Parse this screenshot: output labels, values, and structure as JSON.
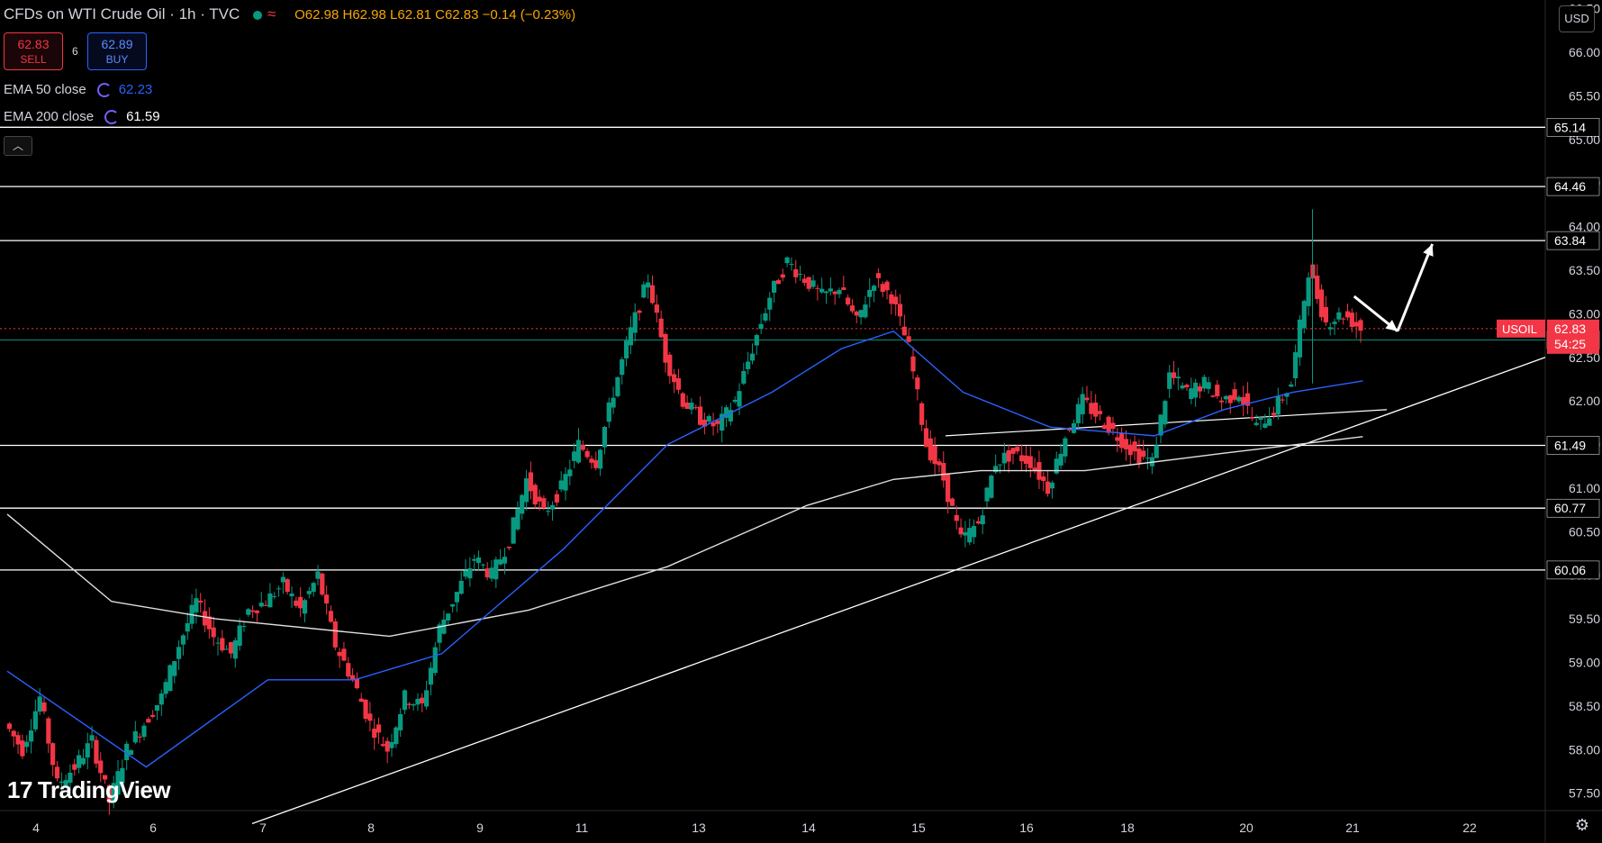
{
  "header": {
    "symbol_title": "CFDs on WTI Crude Oil · 1h · TVC",
    "open": "O62.98",
    "high": "H62.98",
    "low": "L62.81",
    "close": "C62.83",
    "change": "−0.14 (−0.23%)"
  },
  "trade": {
    "sell_price": "62.83",
    "sell_label": "SELL",
    "spread": "6",
    "buy_price": "62.89",
    "buy_label": "BUY"
  },
  "indicators": [
    {
      "label": "EMA 50 close",
      "value": "62.23",
      "color": "#2962ff"
    },
    {
      "label": "EMA 200 close",
      "value": "61.59",
      "color": "#ffffff"
    }
  ],
  "currency": "USD",
  "logo_text": "TradingView",
  "colors": {
    "up": "#089981",
    "down": "#f23645",
    "ema50": "#2962ff",
    "ema200": "#e0e0e0",
    "levels": "#ffffff",
    "background": "#000000"
  },
  "chart_data": {
    "type": "candlestick",
    "symbol": "USOIL",
    "interval": "1h",
    "y_ticks": [
      "57.50",
      "58.00",
      "58.50",
      "59.00",
      "59.50",
      "60.00",
      "60.50",
      "61.00",
      "61.50",
      "62.00",
      "62.50",
      "63.00",
      "63.50",
      "64.00",
      "64.50",
      "65.00",
      "65.50",
      "66.00",
      "66.50"
    ],
    "ylim": [
      57.3,
      66.6
    ],
    "x_ticks": [
      "4",
      "6",
      "7",
      "8",
      "9",
      "11",
      "13",
      "14",
      "15",
      "16",
      "18",
      "20",
      "21",
      "22"
    ],
    "horizontal_levels": [
      65.14,
      64.46,
      63.84,
      61.49,
      60.77,
      60.06
    ],
    "support_level": 62.7,
    "price_label": {
      "symbol": "USOIL",
      "price": "62.83",
      "countdown": "54:25"
    },
    "level_labels": [
      "65.14",
      "64.46",
      "63.84",
      "61.49",
      "60.77",
      "60.06",
      "62.70"
    ],
    "close_path": [
      [
        0,
        58.3
      ],
      [
        1,
        58.0
      ],
      [
        2,
        58.6
      ],
      [
        3,
        57.6
      ],
      [
        4,
        57.8
      ],
      [
        5,
        58.1
      ],
      [
        6,
        57.4
      ],
      [
        7,
        58.0
      ],
      [
        8,
        58.3
      ],
      [
        9,
        58.6
      ],
      [
        10,
        59.2
      ],
      [
        11,
        59.7
      ],
      [
        12,
        59.3
      ],
      [
        13,
        59.1
      ],
      [
        14,
        59.6
      ],
      [
        15,
        59.7
      ],
      [
        16,
        59.9
      ],
      [
        17,
        59.6
      ],
      [
        18,
        60.0
      ],
      [
        19,
        59.2
      ],
      [
        20,
        58.8
      ],
      [
        21,
        58.3
      ],
      [
        22,
        58.0
      ],
      [
        23,
        58.6
      ],
      [
        24,
        58.5
      ],
      [
        25,
        59.4
      ],
      [
        26,
        59.8
      ],
      [
        27,
        60.2
      ],
      [
        28,
        60.0
      ],
      [
        29,
        60.4
      ],
      [
        30,
        61.1
      ],
      [
        31,
        60.7
      ],
      [
        32,
        61.0
      ],
      [
        33,
        61.5
      ],
      [
        34,
        61.3
      ],
      [
        35,
        62.1
      ],
      [
        36,
        62.8
      ],
      [
        37,
        63.4
      ],
      [
        38,
        62.5
      ],
      [
        39,
        62.0
      ],
      [
        40,
        61.8
      ],
      [
        41,
        61.7
      ],
      [
        42,
        62.0
      ],
      [
        43,
        62.6
      ],
      [
        44,
        63.2
      ],
      [
        45,
        63.6
      ],
      [
        46,
        63.4
      ],
      [
        47,
        63.2
      ],
      [
        48,
        63.3
      ],
      [
        49,
        62.9
      ],
      [
        50,
        63.4
      ],
      [
        51,
        63.2
      ],
      [
        52,
        62.6
      ],
      [
        53,
        61.5
      ],
      [
        54,
        61.1
      ],
      [
        55,
        60.4
      ],
      [
        56,
        60.6
      ],
      [
        57,
        61.3
      ],
      [
        58,
        61.4
      ],
      [
        59,
        61.3
      ],
      [
        60,
        61.0
      ],
      [
        61,
        61.6
      ],
      [
        62,
        62.0
      ],
      [
        63,
        61.8
      ],
      [
        64,
        61.6
      ],
      [
        65,
        61.4
      ],
      [
        66,
        61.3
      ],
      [
        67,
        62.3
      ],
      [
        68,
        62.1
      ],
      [
        69,
        62.2
      ],
      [
        70,
        62.0
      ],
      [
        71,
        62.1
      ],
      [
        72,
        61.7
      ],
      [
        73,
        61.9
      ],
      [
        74,
        62.2
      ],
      [
        75,
        63.5
      ],
      [
        76,
        62.9
      ],
      [
        77,
        63.0
      ],
      [
        78,
        62.83
      ]
    ],
    "ema50_path": [
      [
        0,
        58.9
      ],
      [
        8,
        57.8
      ],
      [
        15,
        58.8
      ],
      [
        20,
        58.8
      ],
      [
        25,
        59.1
      ],
      [
        32,
        60.3
      ],
      [
        38,
        61.5
      ],
      [
        44,
        62.1
      ],
      [
        48,
        62.6
      ],
      [
        51,
        62.8
      ],
      [
        55,
        62.1
      ],
      [
        60,
        61.7
      ],
      [
        66,
        61.6
      ],
      [
        70,
        61.9
      ],
      [
        74,
        62.1
      ],
      [
        78,
        62.23
      ]
    ],
    "ema200_path": [
      [
        0,
        60.7
      ],
      [
        6,
        59.7
      ],
      [
        12,
        59.5
      ],
      [
        22,
        59.3
      ],
      [
        30,
        59.6
      ],
      [
        38,
        60.1
      ],
      [
        46,
        60.8
      ],
      [
        51,
        61.1
      ],
      [
        56,
        61.2
      ],
      [
        62,
        61.2
      ],
      [
        70,
        61.4
      ],
      [
        78,
        61.59
      ]
    ],
    "trendline": [
      [
        60.1,
        12
      ],
      [
        62.5,
        80
      ]
    ],
    "arrows": [
      {
        "from": [
          77.5,
          63.2
        ],
        "to": [
          80,
          62.8
        ]
      },
      {
        "from": [
          80,
          62.8
        ],
        "to": [
          82,
          63.8
        ]
      }
    ]
  }
}
